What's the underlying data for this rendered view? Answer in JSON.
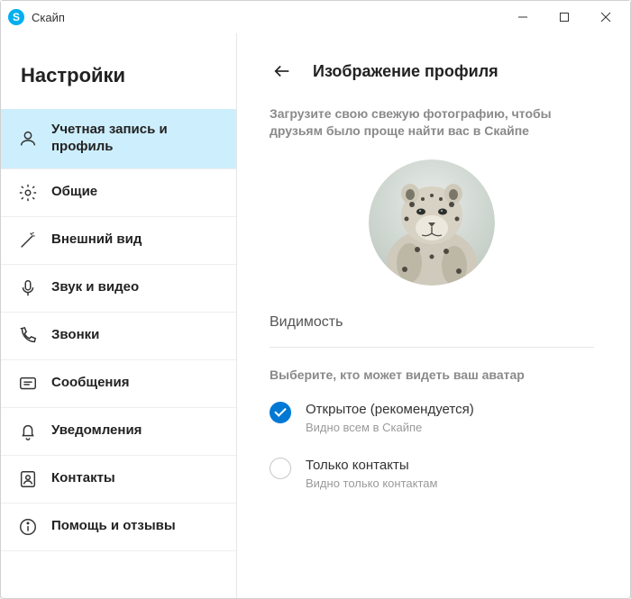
{
  "window": {
    "title": "Скайп"
  },
  "sidebar": {
    "title": "Настройки",
    "items": [
      {
        "label": "Учетная запись и профиль"
      },
      {
        "label": "Общие"
      },
      {
        "label": "Внешний вид"
      },
      {
        "label": "Звук и видео"
      },
      {
        "label": "Звонки"
      },
      {
        "label": "Сообщения"
      },
      {
        "label": "Уведомления"
      },
      {
        "label": "Контакты"
      },
      {
        "label": "Помощь и отзывы"
      }
    ]
  },
  "main": {
    "title": "Изображение профиля",
    "subtitle": "Загрузите свою свежую фотографию, чтобы друзьям было проще найти вас в Скайпе",
    "section_label": "Видимость",
    "hint": "Выберите, кто может видеть ваш аватар",
    "options": [
      {
        "title": "Открытое (рекомендуется)",
        "sub": "Видно всем в Скайпе"
      },
      {
        "title": "Только контакты",
        "sub": "Видно только контактам"
      }
    ]
  }
}
